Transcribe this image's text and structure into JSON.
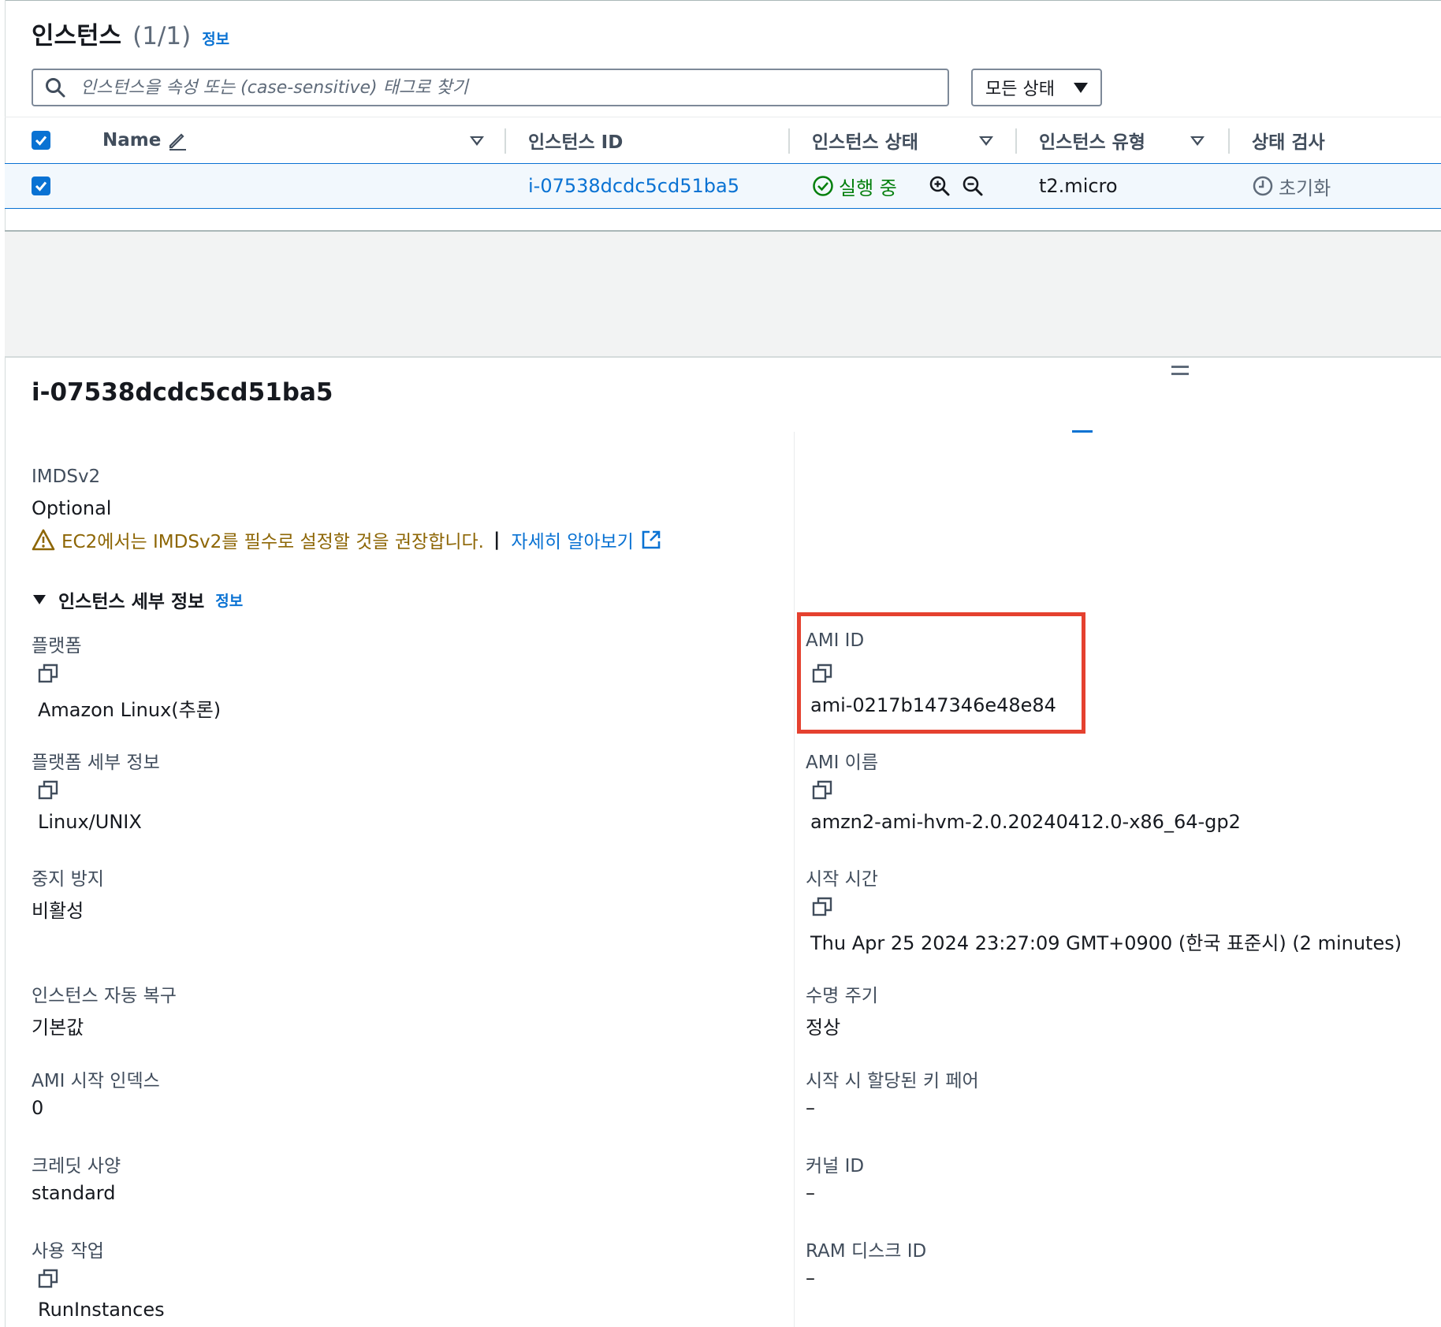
{
  "header": {
    "title": "인스턴스",
    "count": "(1/1)",
    "info_link": "정보"
  },
  "search": {
    "placeholder": "인스턴스을 속성 또는 (case-sensitive) 태그로 찾기"
  },
  "state_filter": {
    "value": "모든 상태"
  },
  "table": {
    "columns": [
      "Name",
      "인스턴스 ID",
      "인스턴스 상태",
      "인스턴스 유형",
      "상태 검사"
    ],
    "row": {
      "name": "",
      "instance_id": "i-07538dcdc5cd51ba5",
      "state": "실행 중",
      "type": "t2.micro",
      "status_check": "초기화"
    }
  },
  "detail": {
    "title": "i-07538dcdc5cd51ba5",
    "imds_label": "IMDSv2",
    "imds_value": "Optional",
    "warning_text": "EC2에서는 IMDSv2를 필수로 설정할 것을 권장합니다.",
    "warning_pipe": "|",
    "learn_more": "자세히 알아보기",
    "section_title": "인스턴스 세부 정보",
    "section_info": "정보",
    "left": {
      "platform_label": "플랫폼",
      "platform_value": "Amazon Linux(추론)",
      "platform_detail_label": "플랫폼 세부 정보",
      "platform_detail_value": "Linux/UNIX",
      "stop_protect_label": "중지 방지",
      "stop_protect_value": "비활성",
      "auto_recovery_label": "인스턴스 자동 복구",
      "auto_recovery_value": "기본값",
      "ami_launch_index_label": "AMI 시작 인덱스",
      "ami_launch_index_value": "0",
      "credit_label": "크레딧 사양",
      "credit_value": "standard",
      "usage_label": "사용 작업",
      "usage_value": "RunInstances"
    },
    "right": {
      "ami_id_label": "AMI ID",
      "ami_id_value": "ami-0217b147346e48e84",
      "ami_name_label": "AMI 이름",
      "ami_name_value": "amzn2-ami-hvm-2.0.20240412.0-x86_64-gp2",
      "launch_time_label": "시작 시간",
      "launch_time_value": "Thu Apr 25 2024 23:27:09 GMT+0900 (한국 표준시) (2 minutes)",
      "lifecycle_label": "수명 주기",
      "lifecycle_value": "정상",
      "keypair_label": "시작 시 할당된 키 페어",
      "keypair_value": "–",
      "kernel_label": "커널 ID",
      "kernel_value": "–",
      "ramdisk_label": "RAM 디스크 ID",
      "ramdisk_value": "–"
    }
  },
  "colors": {
    "link": "#0972d3",
    "success": "#037f0c",
    "warning": "#8d6605",
    "highlight": "#e5412f"
  }
}
